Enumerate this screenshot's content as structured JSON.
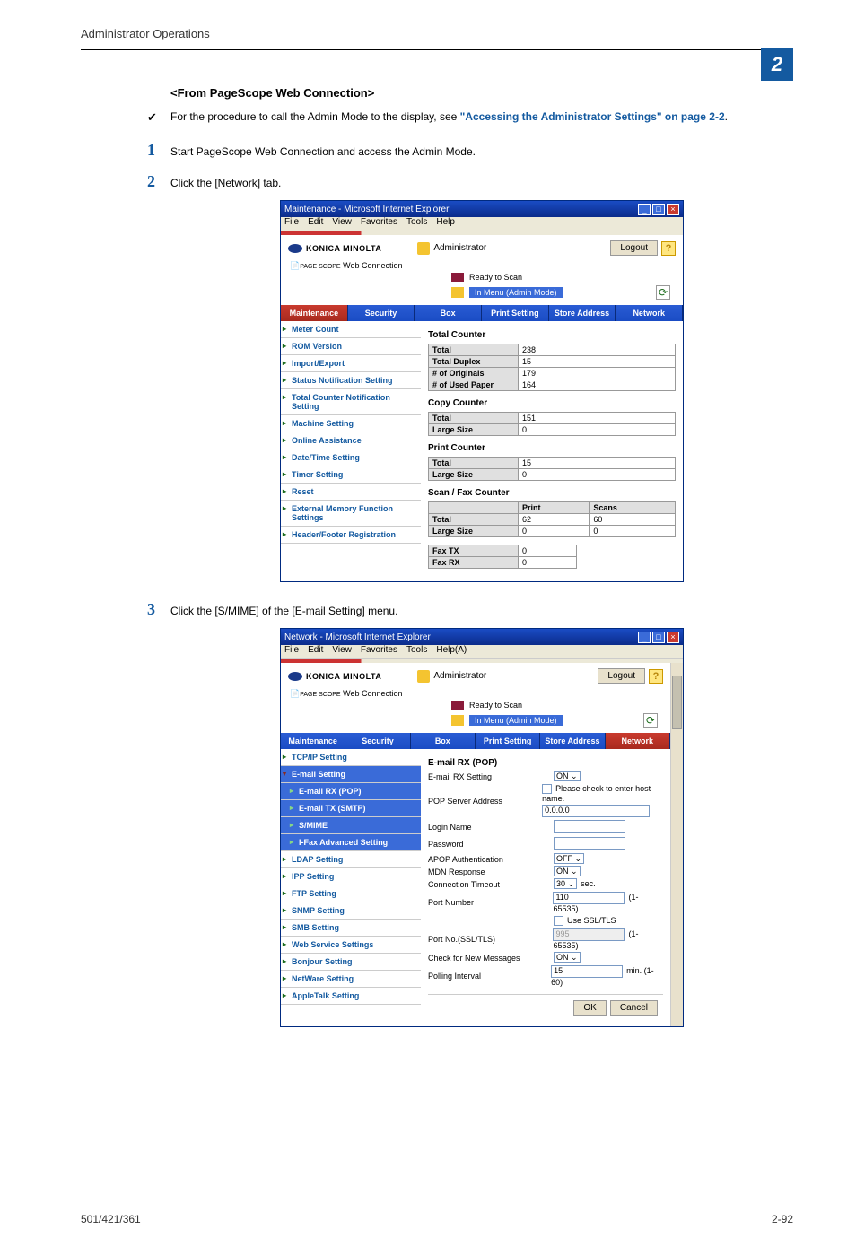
{
  "page_header": "Administrator Operations",
  "chapter_num": "2",
  "footer_left": "501/421/361",
  "footer_right": "2-92",
  "section_heading": "<From PageScope Web Connection>",
  "check_text": "For the procedure to call the Admin Mode to the display, see ",
  "link_text": "\"Accessing the Administrator Settings\" on page 2-2",
  "check_text_end": ".",
  "steps": [
    {
      "num": "1",
      "text": "Start PageScope Web Connection and access the Admin Mode."
    },
    {
      "num": "2",
      "text": "Click the [Network] tab."
    },
    {
      "num": "3",
      "text": "Click the [S/MIME] of the [E-mail Setting] menu."
    }
  ],
  "ie_common": {
    "menus": [
      "File",
      "Edit",
      "View",
      "Favorites",
      "Tools",
      "Help"
    ],
    "menus_b": [
      "File",
      "Edit",
      "View",
      "Favorites",
      "Tools",
      "Help(A)"
    ],
    "logo_brand": "KONICA MINOLTA",
    "web_conn": "Web Connection",
    "admin_label": "Administrator",
    "logout": "Logout",
    "help": "?",
    "ready": "Ready to Scan",
    "mode": "In Menu (Admin Mode)"
  },
  "ss1": {
    "title": "Maintenance - Microsoft Internet Explorer",
    "tabs": [
      "Maintenance",
      "Security",
      "Box",
      "Print Setting",
      "Store Address",
      "Network"
    ],
    "active_tab": 0,
    "sidebar": [
      "Meter Count",
      "ROM Version",
      "Import/Export",
      "Status Notification Setting",
      "Total Counter Notification Setting",
      "Machine Setting",
      "Online Assistance",
      "Date/Time Setting",
      "Timer Setting",
      "Reset",
      "External Memory Function Settings",
      "Header/Footer Registration"
    ],
    "sections": [
      {
        "h": "Total Counter",
        "rows": [
          [
            "Total",
            "238"
          ],
          [
            "Total Duplex",
            "15"
          ],
          [
            "# of Originals",
            "179"
          ],
          [
            "# of Used Paper",
            "164"
          ]
        ]
      },
      {
        "h": "Copy Counter",
        "rows": [
          [
            "Total",
            "151"
          ],
          [
            "Large Size",
            "0"
          ]
        ]
      },
      {
        "h": "Print Counter",
        "rows": [
          [
            "Total",
            "15"
          ],
          [
            "Large Size",
            "0"
          ]
        ]
      }
    ],
    "scanfax": {
      "h": "Scan / Fax Counter",
      "cols": [
        "",
        "Print",
        "Scans"
      ],
      "rows": [
        [
          "Total",
          "62",
          "60"
        ],
        [
          "Large Size",
          "0",
          "0"
        ]
      ],
      "fax": [
        [
          "Fax TX",
          "0"
        ],
        [
          "Fax RX",
          "0"
        ]
      ]
    }
  },
  "ss2": {
    "title": "Network - Microsoft Internet Explorer",
    "tabs": [
      "Maintenance",
      "Security",
      "Box",
      "Print Setting",
      "Store Address",
      "Network"
    ],
    "active_tab": 5,
    "sidebar_top": [
      "TCP/IP Setting"
    ],
    "sidebar_email_head": "E-mail Setting",
    "sidebar_email_sub": [
      "E-mail RX (POP)",
      "E-mail TX (SMTP)",
      "S/MIME",
      "I-Fax Advanced Setting"
    ],
    "sidebar_rest": [
      "LDAP Setting",
      "IPP Setting",
      "FTP Setting",
      "SNMP Setting",
      "SMB Setting",
      "Web Service Settings",
      "Bonjour Setting",
      "NetWare Setting",
      "AppleTalk Setting"
    ],
    "form_h": "E-mail RX (POP)",
    "form_rows": [
      {
        "label": "E-mail RX Setting",
        "type": "select",
        "value": "ON"
      },
      {
        "label": "POP Server Address",
        "type": "addr",
        "check_text": "Please check to enter host name.",
        "value": "0.0.0.0"
      },
      {
        "label": "Login Name",
        "type": "text",
        "value": ""
      },
      {
        "label": "Password",
        "type": "text",
        "value": ""
      },
      {
        "label": "APOP Authentication",
        "type": "select",
        "value": "OFF"
      },
      {
        "label": "MDN Response",
        "type": "select",
        "value": "ON"
      },
      {
        "label": "Connection Timeout",
        "type": "select_hint",
        "value": "30",
        "hint": "sec."
      },
      {
        "label": "Port Number",
        "type": "text_hint",
        "value": "110",
        "hint": "(1-65535)"
      },
      {
        "label": "",
        "type": "check",
        "check_text": "Use SSL/TLS"
      },
      {
        "label": "Port No.(SSL/TLS)",
        "type": "text_hint_disabled",
        "value": "995",
        "hint": "(1-65535)"
      },
      {
        "label": "Check for New Messages",
        "type": "select",
        "value": "ON"
      },
      {
        "label": "Polling Interval",
        "type": "text_hint",
        "value": "15",
        "hint": "min.  (1-60)"
      }
    ],
    "buttons": [
      "OK",
      "Cancel"
    ]
  }
}
